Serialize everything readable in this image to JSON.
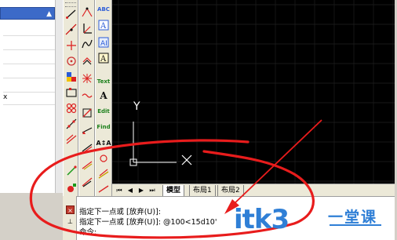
{
  "properties_panel": {
    "rows": [
      "",
      "",
      "",
      "",
      "",
      "",
      "x"
    ],
    "header_arrow": "▲"
  },
  "toolbars": {
    "draw": [
      "line-icon",
      "construction-line-icon",
      "polyline-icon",
      "polygon-icon",
      "rectangle-icon",
      "arc-icon",
      "circle-icon",
      "spline-icon",
      "ellipse-icon",
      "insert-block-icon",
      "make-block-icon",
      "point-icon",
      "hatch-icon",
      "region-icon",
      "table-icon",
      "multiline-text-icon"
    ],
    "modify": [
      "erase-icon",
      "copy-icon",
      "mirror-icon",
      "offset-icon",
      "array-icon",
      "move-icon",
      "rotate-icon",
      "scale-icon",
      "stretch-icon",
      "trim-icon",
      "extend-icon",
      "break-icon",
      "join-icon",
      "chamfer-icon",
      "fillet-icon",
      "explode-icon"
    ],
    "text": {
      "spell": "ABC",
      "text_label": "Text",
      "single_text": "A",
      "edit_text": "Edit",
      "find": "Find",
      "scale_text": "A↕A"
    }
  },
  "canvas": {
    "background": "#000000",
    "grid_color": "#1f1f1f",
    "ucs": {
      "y_label": "Y",
      "x_label": "X"
    }
  },
  "layout_tabs": {
    "nav": [
      "⏮",
      "◀",
      "▶",
      "⏭"
    ],
    "tabs": [
      "模型",
      "布局1",
      "布局2"
    ]
  },
  "command": {
    "lines": [
      "指定下一点或 [放弃(U)]:",
      "指定下一点或 [放弃(U)]: @100<15d10'",
      "命令:"
    ],
    "close": "×",
    "pin": "⊥"
  },
  "annotation": {
    "circle_color": "#e81c1c",
    "arrow_color": "#e81c1c"
  },
  "watermark": {
    "brand": "itk3",
    "site": "一堂课",
    "color": "#2f7fd6"
  }
}
